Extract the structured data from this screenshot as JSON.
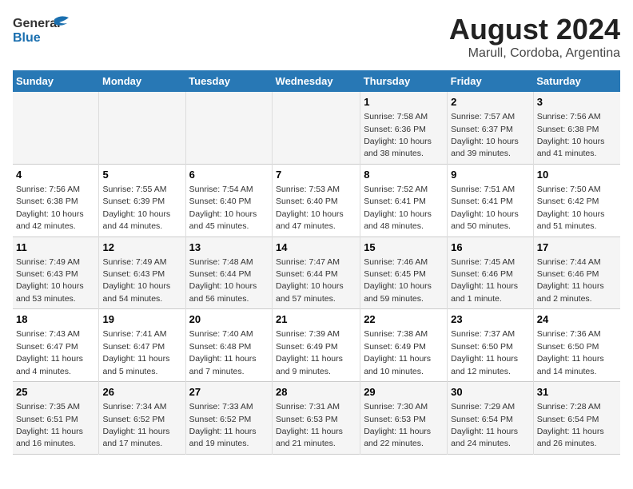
{
  "header": {
    "logo_line1": "General",
    "logo_line2": "Blue",
    "title": "August 2024",
    "subtitle": "Marull, Cordoba, Argentina"
  },
  "days_of_week": [
    "Sunday",
    "Monday",
    "Tuesday",
    "Wednesday",
    "Thursday",
    "Friday",
    "Saturday"
  ],
  "weeks": [
    [
      {
        "day": "",
        "info": ""
      },
      {
        "day": "",
        "info": ""
      },
      {
        "day": "",
        "info": ""
      },
      {
        "day": "",
        "info": ""
      },
      {
        "day": "1",
        "info": "Sunrise: 7:58 AM\nSunset: 6:36 PM\nDaylight: 10 hours and 38 minutes."
      },
      {
        "day": "2",
        "info": "Sunrise: 7:57 AM\nSunset: 6:37 PM\nDaylight: 10 hours and 39 minutes."
      },
      {
        "day": "3",
        "info": "Sunrise: 7:56 AM\nSunset: 6:38 PM\nDaylight: 10 hours and 41 minutes."
      }
    ],
    [
      {
        "day": "4",
        "info": "Sunrise: 7:56 AM\nSunset: 6:38 PM\nDaylight: 10 hours and 42 minutes."
      },
      {
        "day": "5",
        "info": "Sunrise: 7:55 AM\nSunset: 6:39 PM\nDaylight: 10 hours and 44 minutes."
      },
      {
        "day": "6",
        "info": "Sunrise: 7:54 AM\nSunset: 6:40 PM\nDaylight: 10 hours and 45 minutes."
      },
      {
        "day": "7",
        "info": "Sunrise: 7:53 AM\nSunset: 6:40 PM\nDaylight: 10 hours and 47 minutes."
      },
      {
        "day": "8",
        "info": "Sunrise: 7:52 AM\nSunset: 6:41 PM\nDaylight: 10 hours and 48 minutes."
      },
      {
        "day": "9",
        "info": "Sunrise: 7:51 AM\nSunset: 6:41 PM\nDaylight: 10 hours and 50 minutes."
      },
      {
        "day": "10",
        "info": "Sunrise: 7:50 AM\nSunset: 6:42 PM\nDaylight: 10 hours and 51 minutes."
      }
    ],
    [
      {
        "day": "11",
        "info": "Sunrise: 7:49 AM\nSunset: 6:43 PM\nDaylight: 10 hours and 53 minutes."
      },
      {
        "day": "12",
        "info": "Sunrise: 7:49 AM\nSunset: 6:43 PM\nDaylight: 10 hours and 54 minutes."
      },
      {
        "day": "13",
        "info": "Sunrise: 7:48 AM\nSunset: 6:44 PM\nDaylight: 10 hours and 56 minutes."
      },
      {
        "day": "14",
        "info": "Sunrise: 7:47 AM\nSunset: 6:44 PM\nDaylight: 10 hours and 57 minutes."
      },
      {
        "day": "15",
        "info": "Sunrise: 7:46 AM\nSunset: 6:45 PM\nDaylight: 10 hours and 59 minutes."
      },
      {
        "day": "16",
        "info": "Sunrise: 7:45 AM\nSunset: 6:46 PM\nDaylight: 11 hours and 1 minute."
      },
      {
        "day": "17",
        "info": "Sunrise: 7:44 AM\nSunset: 6:46 PM\nDaylight: 11 hours and 2 minutes."
      }
    ],
    [
      {
        "day": "18",
        "info": "Sunrise: 7:43 AM\nSunset: 6:47 PM\nDaylight: 11 hours and 4 minutes."
      },
      {
        "day": "19",
        "info": "Sunrise: 7:41 AM\nSunset: 6:47 PM\nDaylight: 11 hours and 5 minutes."
      },
      {
        "day": "20",
        "info": "Sunrise: 7:40 AM\nSunset: 6:48 PM\nDaylight: 11 hours and 7 minutes."
      },
      {
        "day": "21",
        "info": "Sunrise: 7:39 AM\nSunset: 6:49 PM\nDaylight: 11 hours and 9 minutes."
      },
      {
        "day": "22",
        "info": "Sunrise: 7:38 AM\nSunset: 6:49 PM\nDaylight: 11 hours and 10 minutes."
      },
      {
        "day": "23",
        "info": "Sunrise: 7:37 AM\nSunset: 6:50 PM\nDaylight: 11 hours and 12 minutes."
      },
      {
        "day": "24",
        "info": "Sunrise: 7:36 AM\nSunset: 6:50 PM\nDaylight: 11 hours and 14 minutes."
      }
    ],
    [
      {
        "day": "25",
        "info": "Sunrise: 7:35 AM\nSunset: 6:51 PM\nDaylight: 11 hours and 16 minutes."
      },
      {
        "day": "26",
        "info": "Sunrise: 7:34 AM\nSunset: 6:52 PM\nDaylight: 11 hours and 17 minutes."
      },
      {
        "day": "27",
        "info": "Sunrise: 7:33 AM\nSunset: 6:52 PM\nDaylight: 11 hours and 19 minutes."
      },
      {
        "day": "28",
        "info": "Sunrise: 7:31 AM\nSunset: 6:53 PM\nDaylight: 11 hours and 21 minutes."
      },
      {
        "day": "29",
        "info": "Sunrise: 7:30 AM\nSunset: 6:53 PM\nDaylight: 11 hours and 22 minutes."
      },
      {
        "day": "30",
        "info": "Sunrise: 7:29 AM\nSunset: 6:54 PM\nDaylight: 11 hours and 24 minutes."
      },
      {
        "day": "31",
        "info": "Sunrise: 7:28 AM\nSunset: 6:54 PM\nDaylight: 11 hours and 26 minutes."
      }
    ]
  ]
}
